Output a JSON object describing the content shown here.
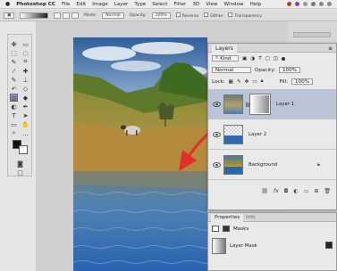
{
  "menubar": {
    "apple": "",
    "app_name": "Photoshop CC",
    "items": [
      "File",
      "Edit",
      "Image",
      "Layer",
      "Type",
      "Select",
      "Filter",
      "3D",
      "View",
      "Window",
      "Help"
    ]
  },
  "optbar": {
    "mode_label": "Mode:",
    "mode_value": "Normal",
    "opacity_label": "Opacity:",
    "opacity_value": "100%",
    "reverse": "Reverse",
    "dither": "Dither",
    "transparency": "Transparency"
  },
  "layers_panel": {
    "title": "Layers",
    "kind": "Kind",
    "blend_mode": "Normal",
    "opacity_label": "Opacity:",
    "opacity_value": "100%",
    "lock_label": "Lock:",
    "fill_label": "Fill:",
    "fill_value": "100%",
    "layers": [
      {
        "name": "Layer 1"
      },
      {
        "name": "Layer 2"
      },
      {
        "name": "Background"
      }
    ]
  },
  "properties_panel": {
    "tab_properties": "Properties",
    "tab_info": "Info",
    "masks_label": "Masks",
    "layer_mask_label": "Layer Mask"
  },
  "colors": {
    "arrow": "#e0302a",
    "panel_bg": "#e9e9e9",
    "selected_layer": "#b9c4d6"
  }
}
